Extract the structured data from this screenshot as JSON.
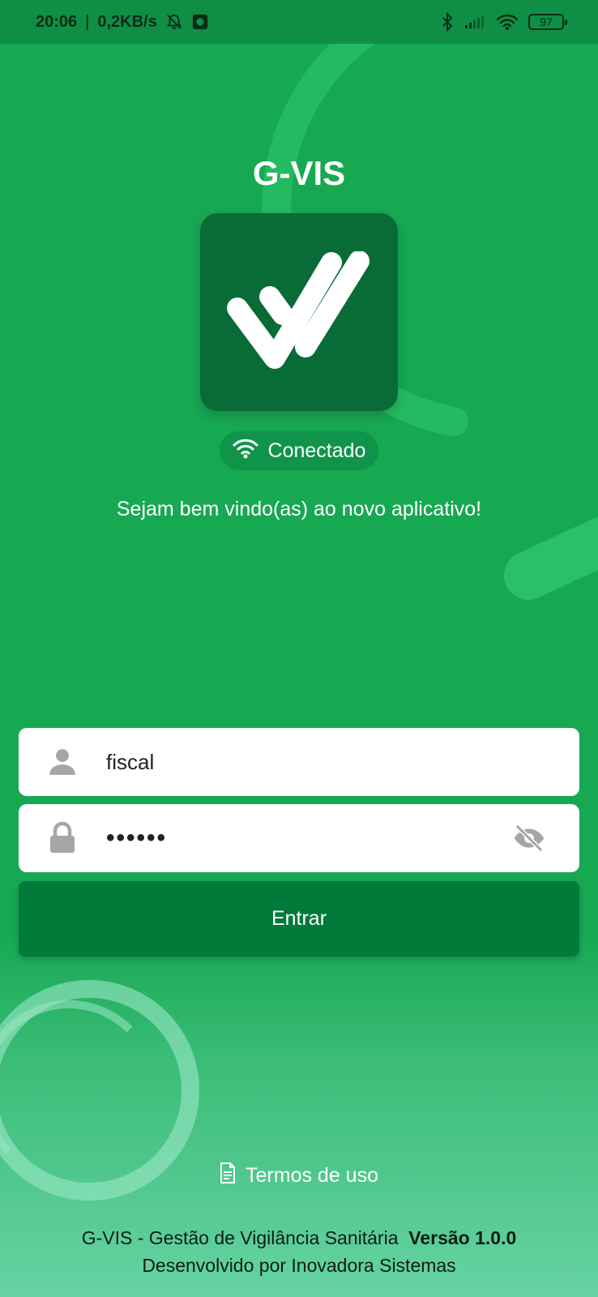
{
  "status_bar": {
    "time": "20:06",
    "speed": "0,2KB/s",
    "battery": "97"
  },
  "app": {
    "title": "G-VIS",
    "connection_status": "Conectado",
    "welcome": "Sejam bem vindo(as) ao novo aplicativo!"
  },
  "login": {
    "username_value": "fiscal",
    "password_masked": "••••••",
    "submit_label": "Entrar"
  },
  "footer": {
    "terms_label": "Termos de uso",
    "product_name": "G-VIS - Gestão de Vigilância Sanitária",
    "version": "Versão 1.0.0",
    "developer": "Desenvolvido por Inovadora Sistemas"
  },
  "colors": {
    "background": "#17a852",
    "logo_bg": "#096b35",
    "button": "#007b3a",
    "pill": "#0f944a"
  },
  "icons": {
    "status": [
      "bell-off-icon",
      "app-notification-icon",
      "bluetooth-icon",
      "signal-icon",
      "wifi-icon",
      "battery-icon"
    ],
    "connection": "wifi-icon",
    "user_field": "user-icon",
    "password_field": "lock-icon",
    "toggle_password": "eye-off-icon",
    "terms": "document-icon"
  }
}
